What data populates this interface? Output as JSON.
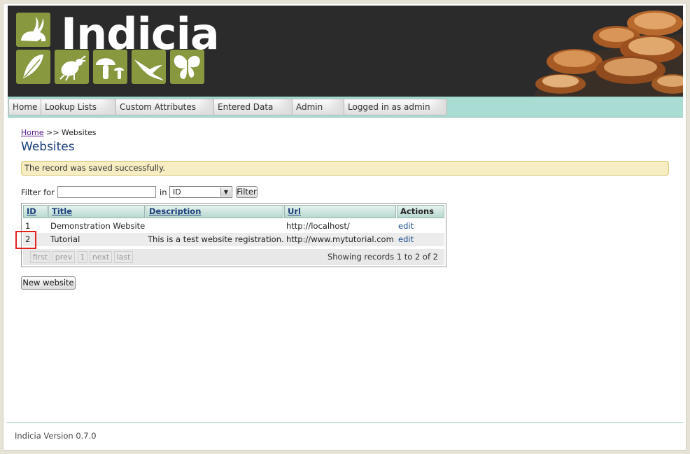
{
  "header": {
    "brand": "Indicia",
    "logo_icons": [
      "rabbit-icon",
      "leaf-icon",
      "beetle-icon",
      "mushroom-icon",
      "bird-icon",
      "butterfly-icon"
    ]
  },
  "nav": {
    "items": [
      {
        "label": "Home"
      },
      {
        "label": "Lookup Lists"
      },
      {
        "label": "Custom Attributes"
      },
      {
        "label": "Entered Data"
      },
      {
        "label": "Admin"
      },
      {
        "label": "Logged in as admin"
      }
    ]
  },
  "breadcrumb": {
    "home": "Home",
    "separator": ">>",
    "current": "Websites"
  },
  "page": {
    "title": "Websites"
  },
  "notice": {
    "text": "The record was saved successfully."
  },
  "filter": {
    "label": "Filter for",
    "value": "",
    "in_label": "in",
    "field_selected": "ID",
    "button": "Filter"
  },
  "table": {
    "columns": [
      "ID",
      "Title",
      "Description",
      "Url",
      "Actions"
    ],
    "rows": [
      {
        "id": "1",
        "title": "Demonstration Website",
        "description": "",
        "url": "http://localhost/",
        "action": "edit"
      },
      {
        "id": "2",
        "title": "Tutorial",
        "description": "This is a test website registration.",
        "url": "http://www.mytutorial.com",
        "action": "edit"
      }
    ],
    "pager": {
      "first": "first",
      "prev": "prev",
      "page": "1",
      "next": "next",
      "last": "last",
      "showing": "Showing records 1 to 2 of 2"
    }
  },
  "new_button": "New website",
  "footer": {
    "version": "Indicia Version 0.7.0"
  },
  "colors": {
    "header_bg": "#2b2b2b",
    "tile_green": "#87983f",
    "nav_bar": "#a9dcd3",
    "title_blue": "#1a3f7a",
    "notice_bg": "#f7edc3",
    "highlight": "#e0211f"
  }
}
